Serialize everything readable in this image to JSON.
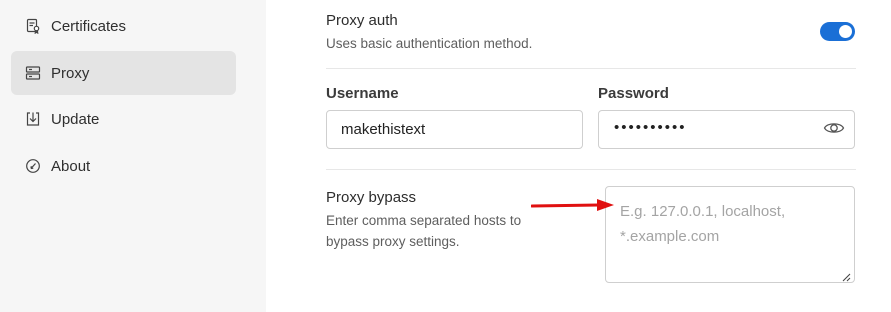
{
  "sidebar": {
    "items": [
      {
        "label": "Certificates",
        "icon": "certificate-icon",
        "active": false
      },
      {
        "label": "Proxy",
        "icon": "proxy-server-icon",
        "active": true
      },
      {
        "label": "Update",
        "icon": "update-download-icon",
        "active": false
      },
      {
        "label": "About",
        "icon": "about-icon",
        "active": false
      }
    ]
  },
  "proxy_auth": {
    "title": "Proxy auth",
    "description": "Uses basic authentication method.",
    "enabled": true
  },
  "credentials": {
    "username_label": "Username",
    "username_value": "makethistext",
    "password_label": "Password",
    "password_masked": "••••••••••"
  },
  "proxy_bypass": {
    "title": "Proxy bypass",
    "description_line1": "Enter comma separated hosts to",
    "description_line2": "bypass proxy settings.",
    "placeholder": "E.g. 127.0.0.1, localhost, *.example.com"
  },
  "colors": {
    "accent": "#1a6fd6",
    "annotation_arrow": "#e01010"
  }
}
